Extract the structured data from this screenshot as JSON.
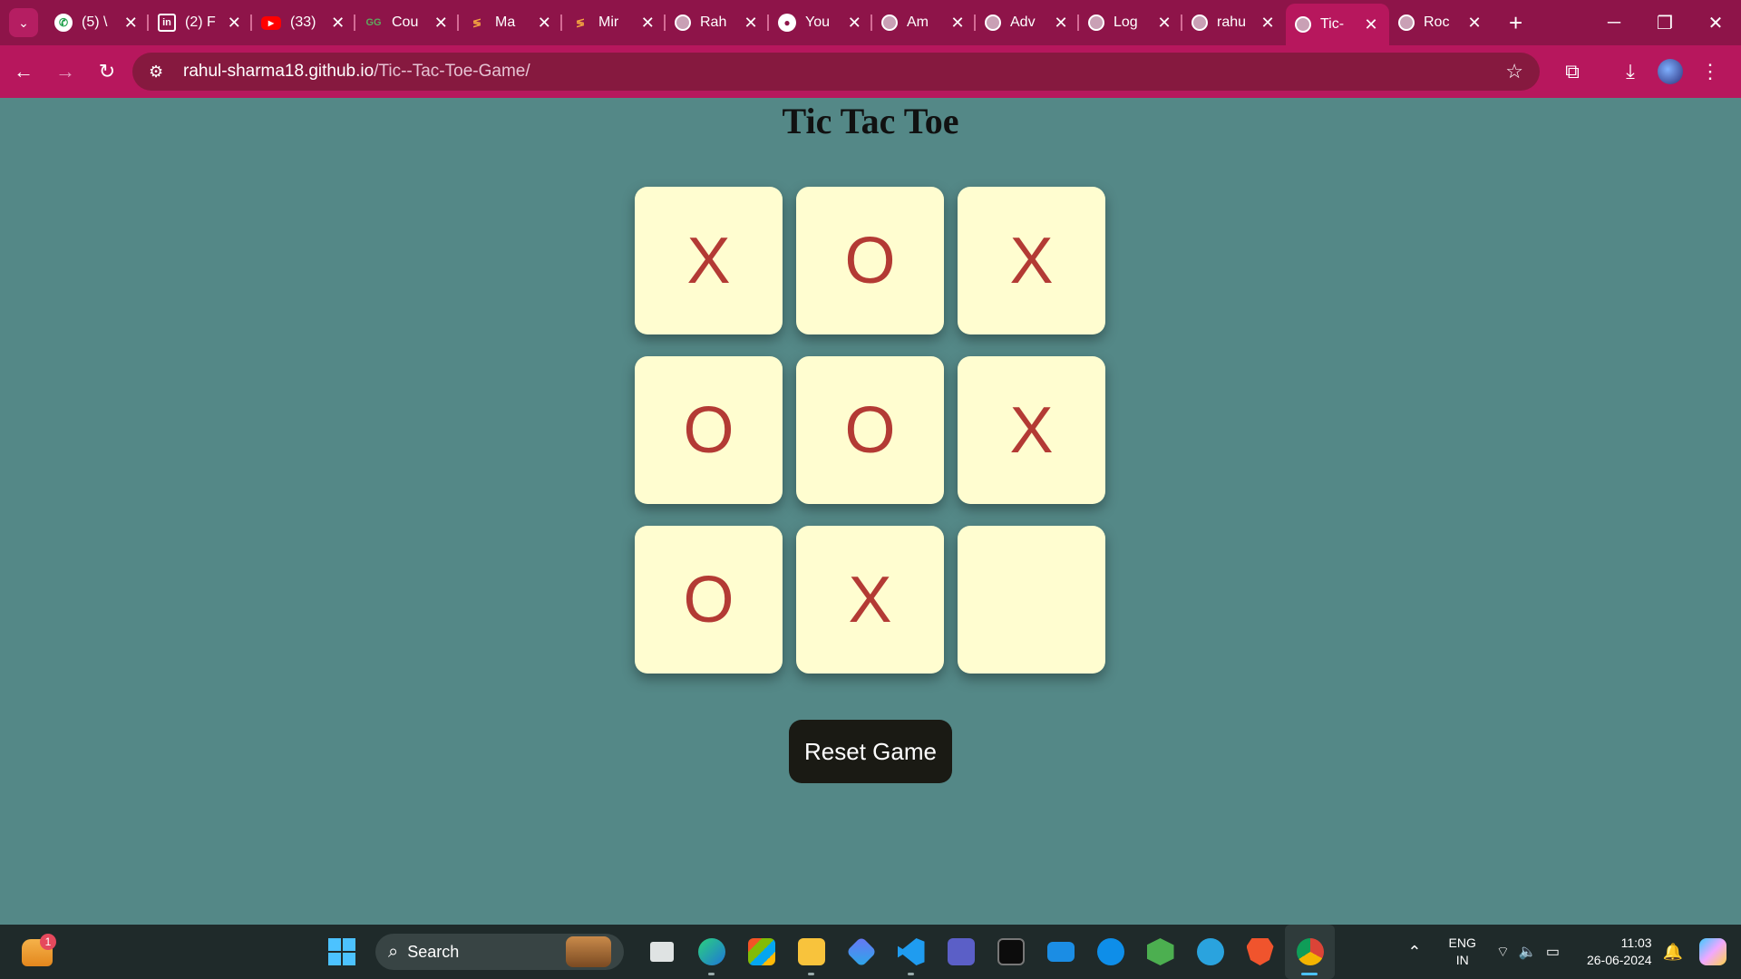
{
  "browser": {
    "tabs": [
      {
        "icon": "whatsapp-icon",
        "label": "(5) \\",
        "active": false
      },
      {
        "icon": "linkedin-icon",
        "label": "(2) F",
        "active": false
      },
      {
        "icon": "youtube-icon",
        "label": "(33)",
        "active": false
      },
      {
        "icon": "gfg-icon",
        "label": "Cou",
        "active": false
      },
      {
        "icon": "deeplearning-icon",
        "label": "Ma",
        "active": false
      },
      {
        "icon": "deeplearning-icon",
        "label": "Mir",
        "active": false
      },
      {
        "icon": "globe-icon",
        "label": "Rah",
        "active": false
      },
      {
        "icon": "github-icon",
        "label": "You",
        "active": false
      },
      {
        "icon": "globe-icon",
        "label": "Am",
        "active": false
      },
      {
        "icon": "globe-icon",
        "label": "Adv",
        "active": false
      },
      {
        "icon": "globe-icon",
        "label": "Log",
        "active": false
      },
      {
        "icon": "globe-icon",
        "label": "rahu",
        "active": false
      },
      {
        "icon": "globe-icon",
        "label": "Tic-",
        "active": true
      },
      {
        "icon": "globe-icon",
        "label": "Roc",
        "active": false
      }
    ],
    "url_host": "rahul-sharma18.github.io",
    "url_path": "/Tic--Tac-Toe-Game/"
  },
  "game": {
    "title": "Tic Tac Toe",
    "board": [
      "X",
      "O",
      "X",
      "O",
      "O",
      "X",
      "O",
      "X",
      ""
    ],
    "reset_label": "Reset Game",
    "mark_color": "#b33a34",
    "cell_color": "#fffdd0",
    "page_bg": "#548887"
  },
  "taskbar": {
    "weather_badge": "1",
    "search_placeholder": "Search",
    "apps": [
      "task-view-icon",
      "edge-icon",
      "store-icon",
      "file-explorer-icon",
      "copilot-app-icon",
      "vscode-icon",
      "teams-icon",
      "terminal-icon",
      "mail-icon",
      "teamviewer-icon",
      "nodejs-icon",
      "telegram-icon",
      "brave-icon",
      "chrome-icon"
    ],
    "lang_line1": "ENG",
    "lang_line2": "IN",
    "time": "11:03",
    "date": "26-06-2024"
  }
}
